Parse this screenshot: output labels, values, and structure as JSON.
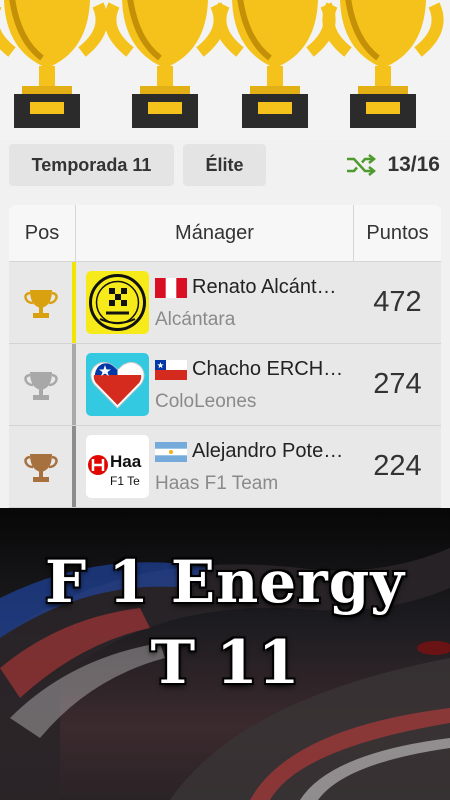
{
  "filters": {
    "season_label": "Temporada 11",
    "league_label": "Élite",
    "round_text": "13/16"
  },
  "table": {
    "headers": {
      "pos": "Pos",
      "manager": "Mánager",
      "points": "Puntos"
    },
    "rows": [
      {
        "position_icon": "gold-trophy-icon",
        "team_logo": "alcantara-logo",
        "flag": "peru-flag",
        "manager": "Renato Alcántara",
        "team": "Alcántara",
        "points": "472",
        "accent": "#f2e600"
      },
      {
        "position_icon": "silver-trophy-icon",
        "team_logo": "chile-heart-logo",
        "flag": "chile-flag",
        "manager": "Chacho ERCHILE",
        "team": "ColoLeones",
        "points": "274",
        "accent": "#a9a9a9"
      },
      {
        "position_icon": "bronze-trophy-icon",
        "team_logo": "haas-logo",
        "flag": "argentina-flag",
        "manager": "Alejandro Potente",
        "team": "Haas F1 Team",
        "points": "224",
        "accent": "#8c8c8c"
      }
    ]
  },
  "promo": {
    "line1": "F 1 Energy",
    "line2": "T 11"
  },
  "colors": {
    "gold": "#d9a010",
    "silver": "#a8a8a8",
    "bronze": "#a6713f",
    "shuffle_green": "#4f9a2c",
    "trophy_yellow": "#f4c21a"
  }
}
